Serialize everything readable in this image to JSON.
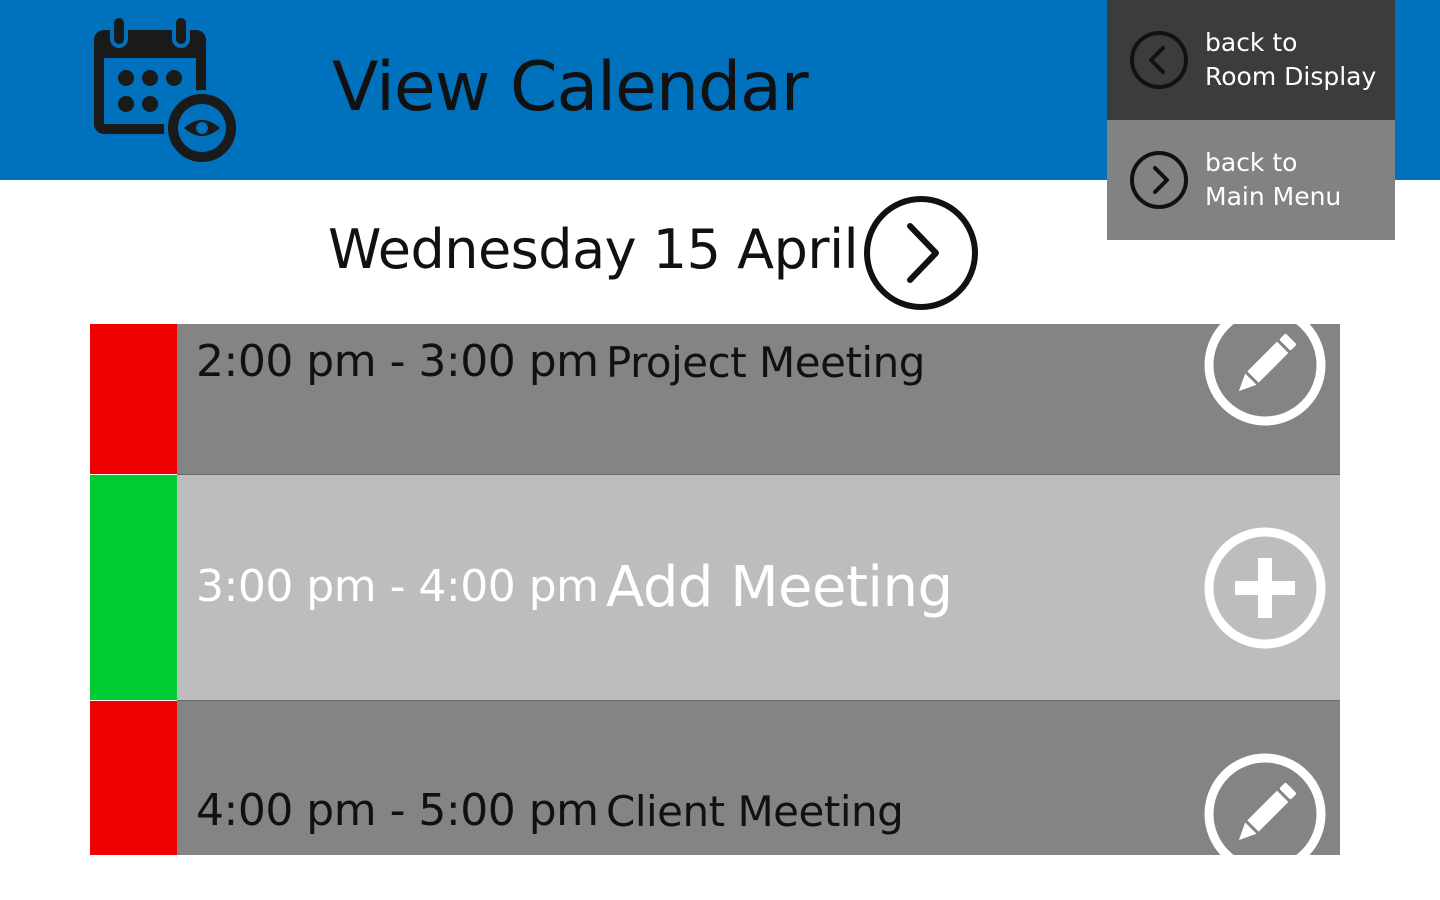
{
  "header": {
    "title": "View Calendar",
    "icon": "calendar-eye-icon",
    "background": "#0071bc"
  },
  "nav": {
    "room_display": {
      "line1": "back to",
      "line2": "Room Display",
      "icon": "chevron-left-circle-icon"
    },
    "main_menu": {
      "line1": "back to",
      "line2": "Main Menu",
      "icon": "chevron-right-circle-icon"
    }
  },
  "date": {
    "label": "Wednesday 15 April",
    "next_icon": "chevron-right-circle-icon"
  },
  "slots": [
    {
      "time": "2:00 pm - 3:00 pm",
      "title": "Project Meeting",
      "status": "booked",
      "status_color": "#ee0000",
      "action_icon": "pencil-icon"
    },
    {
      "time": "3:00 pm - 4:00 pm",
      "title": "Add Meeting",
      "status": "available",
      "status_color": "#00cc33",
      "action_icon": "plus-icon"
    },
    {
      "time": "4:00 pm - 5:00 pm",
      "title": "Client Meeting",
      "status": "booked",
      "status_color": "#ee0000",
      "action_icon": "pencil-icon"
    }
  ]
}
